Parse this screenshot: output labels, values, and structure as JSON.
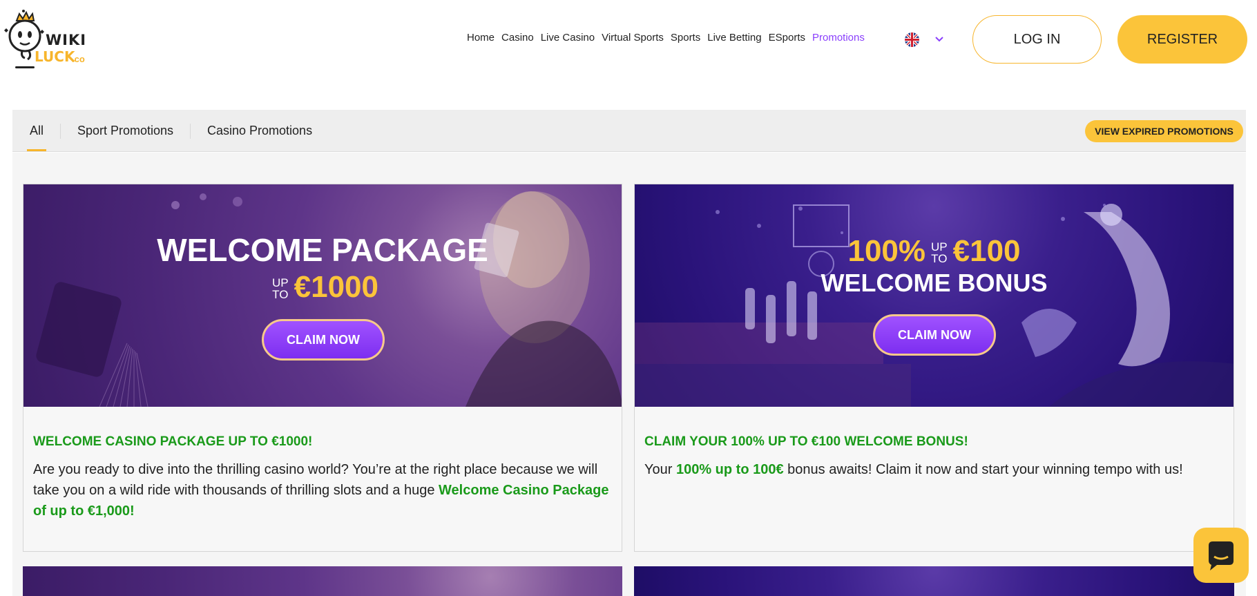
{
  "logo": {
    "top": "WIKI",
    "bottom": "LUCK",
    "suffix": ".co"
  },
  "nav": {
    "items": [
      "Home",
      "Casino",
      "Live Casino",
      "Virtual Sports",
      "Sports",
      "Live Betting",
      "ESports",
      "Promotions"
    ],
    "active": "Promotions",
    "language": "EN"
  },
  "auth": {
    "login_label": "LOG IN",
    "register_label": "REGISTER"
  },
  "filters": {
    "tabs": [
      "All",
      "Sport Promotions",
      "Casino Promotions"
    ],
    "active_tab": "All",
    "expired_label": "VIEW EXPIRED PROMOTIONS"
  },
  "promotions": [
    {
      "banner_line1": "WELCOME PACKAGE",
      "banner_upto_1": "UP",
      "banner_upto_2": "TO",
      "banner_amount": "€1000",
      "claim_label": "CLAIM NOW",
      "title": "WELCOME CASINO PACKAGE UP TO €1000!",
      "desc_text": "Are you ready to dive into the thrilling casino world? You’re at the right place because we will take you on a wild ride with thousands of thrilling slots and a huge ",
      "desc_highlight": "Welcome Casino Package of up to €1,000!"
    },
    {
      "banner_percent": "100%",
      "banner_upto_1": "UP",
      "banner_upto_2": "TO",
      "banner_amount": "€100",
      "banner_line2": "WELCOME BONUS",
      "claim_label": "CLAIM NOW",
      "title": "CLAIM YOUR 100% UP TO €100 WELCOME BONUS!",
      "desc_prefix": "Your ",
      "desc_highlight": "100% up to 100€",
      "desc_suffix": " bonus awaits! Claim it now and start your winning tempo with us!"
    }
  ],
  "colors": {
    "accent_yellow": "#fbc43a",
    "accent_purple": "#8a3ffc",
    "highlight_green": "#1a9a1a"
  }
}
